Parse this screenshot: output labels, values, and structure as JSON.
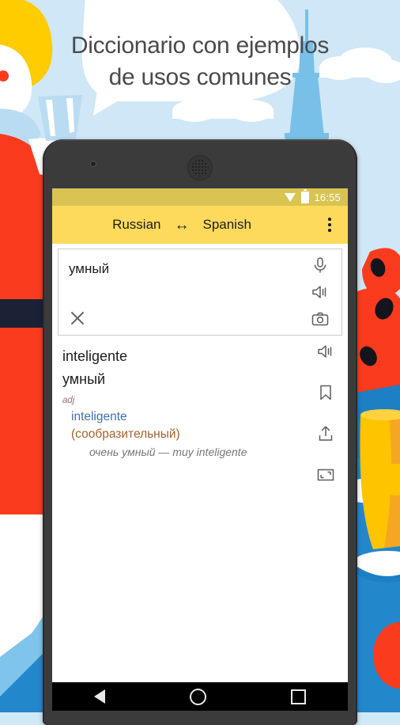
{
  "promo": {
    "headline_line1": "Diccionario con ejemplos",
    "headline_line2": "de usos comunes",
    "headline_color": "#4a4a4a",
    "background_color": "#cfe7f6"
  },
  "phone": {
    "statusbar": {
      "time": "16:55",
      "wifi_icon": "wifi-icon",
      "battery_icon": "battery-icon",
      "background_color": "#d9c352"
    },
    "toolbar": {
      "source_language": "Russian",
      "swap_arrow": "↔",
      "target_language": "Spanish",
      "overflow_icon": "overflow-menu-icon",
      "background_color": "#fdda5c"
    },
    "search": {
      "query": "умный",
      "placeholder": "",
      "clear_icon": "close-icon",
      "mic_icon": "microphone-icon",
      "speaker_icon": "speaker-icon",
      "camera_icon": "camera-icon"
    },
    "result": {
      "headword_translation": "inteligente",
      "headword_source": "умный",
      "part_of_speech": "adj",
      "part_of_speech_color": "#9b6a7a",
      "translation_main": "inteligente",
      "translation_main_color": "#3f72a3",
      "translation_alt": "(сообразительный)",
      "translation_alt_color": "#a4622f",
      "example": "очень умный — muy inteligente",
      "example_color": "#767676",
      "icons": {
        "speaker": "speaker-icon",
        "bookmark": "bookmark-icon",
        "share": "share-upload-icon",
        "fullscreen": "fullscreen-icon"
      }
    },
    "navbar": {
      "back": "back-nav-icon",
      "home": "home-nav-icon",
      "recents": "recents-nav-icon"
    }
  }
}
